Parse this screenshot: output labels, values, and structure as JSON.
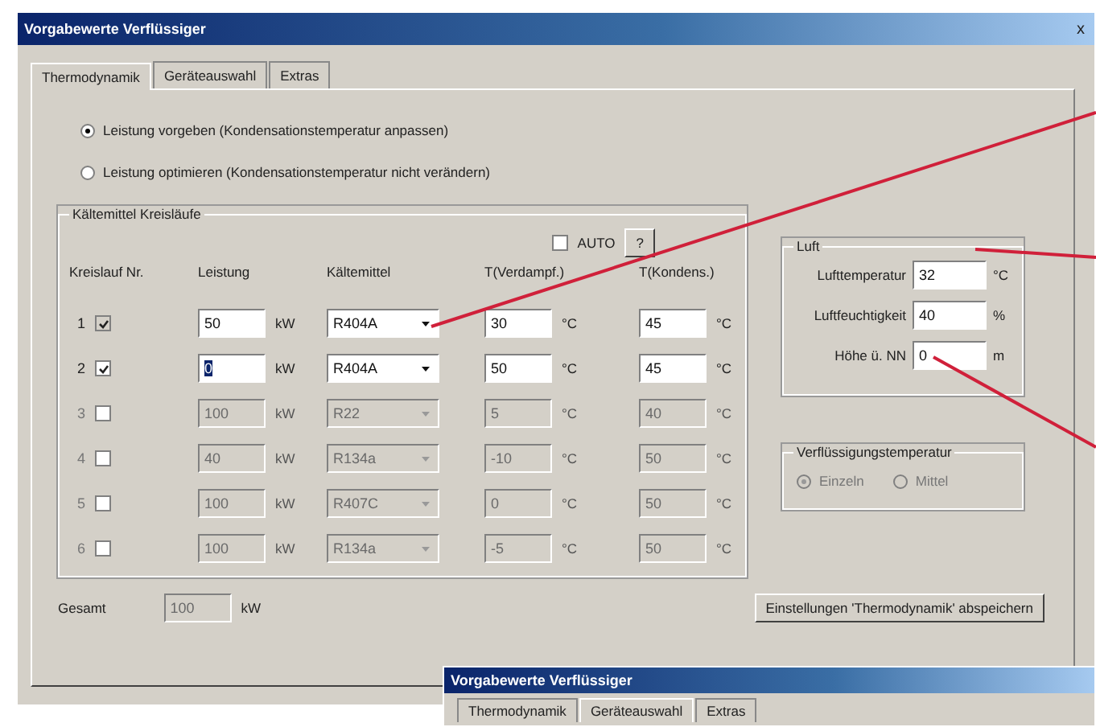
{
  "window": {
    "title": "Vorgabewerte Verflüssiger",
    "close": "x"
  },
  "tabs": [
    {
      "label": "Thermodynamik",
      "selected": true
    },
    {
      "label": "Geräteauswahl",
      "selected": false
    },
    {
      "label": "Extras",
      "selected": false
    }
  ],
  "modes": [
    {
      "label": "Leistung vorgeben (Kondensationstemperatur anpassen)",
      "selected": true
    },
    {
      "label": "Leistung optimieren (Kondensationstemperatur nicht verändern)",
      "selected": false
    }
  ],
  "circuits": {
    "title": "Kältemittel Kreisläufe",
    "auto": {
      "label": "AUTO",
      "checked": false
    },
    "help_button": "?",
    "columns": [
      "Kreislauf Nr.",
      "Leistung",
      "Kältemittel",
      "T(Verdampf.)",
      "T(Kondens.)"
    ],
    "rows": [
      {
        "number": "1",
        "checked": true,
        "disabled": false,
        "power": "50",
        "power_unit": "kW",
        "refrigerant": "R404A",
        "t_evap": "30",
        "t_evap_unit": "°C",
        "t_cond": "45",
        "t_cond_unit": "°C"
      },
      {
        "number": "2",
        "checked": true,
        "disabled": false,
        "power": "0",
        "power_unit": "kW",
        "refrigerant": "R404A",
        "t_evap": "50",
        "t_evap_unit": "°C",
        "t_cond": "45",
        "t_cond_unit": "°C"
      },
      {
        "number": "3",
        "checked": false,
        "disabled": true,
        "power": "100",
        "power_unit": "kW",
        "refrigerant": "R22",
        "t_evap": "5",
        "t_evap_unit": "°C",
        "t_cond": "40",
        "t_cond_unit": "°C"
      },
      {
        "number": "4",
        "checked": false,
        "disabled": true,
        "power": "40",
        "power_unit": "kW",
        "refrigerant": "R134a",
        "t_evap": "-10",
        "t_evap_unit": "°C",
        "t_cond": "50",
        "t_cond_unit": "°C"
      },
      {
        "number": "5",
        "checked": false,
        "disabled": true,
        "power": "100",
        "power_unit": "kW",
        "refrigerant": "R407C",
        "t_evap": "0",
        "t_evap_unit": "°C",
        "t_cond": "50",
        "t_cond_unit": "°C"
      },
      {
        "number": "6",
        "checked": false,
        "disabled": true,
        "power": "100",
        "power_unit": "kW",
        "refrigerant": "R134a",
        "t_evap": "-5",
        "t_evap_unit": "°C",
        "t_cond": "50",
        "t_cond_unit": "°C"
      }
    ],
    "total": {
      "label": "Gesamt",
      "value": "100",
      "unit": "kW"
    }
  },
  "air": {
    "title": "Luft",
    "fields": [
      {
        "label": "Lufttemperatur",
        "value": "32",
        "unit": "°C"
      },
      {
        "label": "Luftfeuchtigkeit",
        "value": "40",
        "unit": "%"
      },
      {
        "label": "Höhe ü. NN",
        "value": "0",
        "unit": "m"
      }
    ]
  },
  "condensing": {
    "title": "Verflüssigungstemperatur",
    "disabled": true,
    "options": [
      {
        "label": "Einzeln",
        "selected": true
      },
      {
        "label": "Mittel",
        "selected": false
      }
    ]
  },
  "save_button": "Einstellungen 'Thermodynamik' abspeichern",
  "second_window": {
    "title": "Vorgabewerte Verflüssiger",
    "tabs": [
      {
        "label": "Thermodynamik",
        "selected": false
      },
      {
        "label": "Geräteauswahl",
        "selected": true
      },
      {
        "label": "Extras",
        "selected": false
      }
    ]
  }
}
